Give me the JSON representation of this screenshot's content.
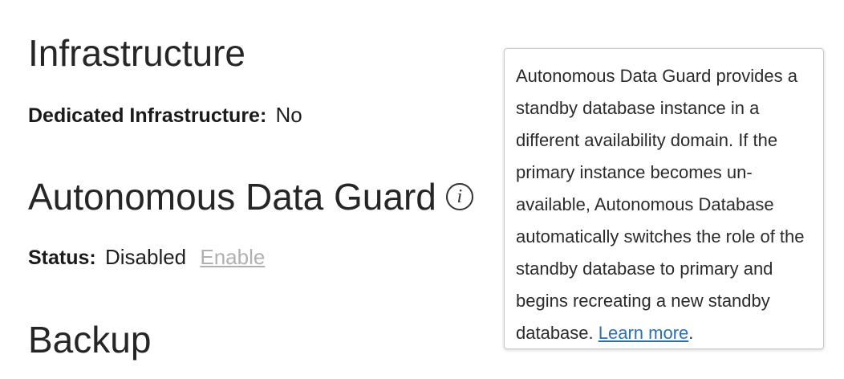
{
  "sections": {
    "infrastructure": {
      "heading": "Infrastructure",
      "dedicated_label": "Dedicated Infrastructure:",
      "dedicated_value": "No"
    },
    "data_guard": {
      "heading": "Autonomous Data Guard",
      "info_icon_glyph": "i",
      "status_label": "Status:",
      "status_value": "Disabled",
      "enable_link": "Enable"
    },
    "backup": {
      "heading": "Backup"
    }
  },
  "tooltip": {
    "body": "Autonomous Data Guard provides a standby database instance in a different availability domain. If the primary instance becomes un-available, Autonomous Database automatically switches the role of the standby database to primary and begins recreating a new standby database.",
    "link_text": "Learn more",
    "trailing": "."
  },
  "icons": {
    "info": "info-circle-icon"
  },
  "colors": {
    "link": "#2c6fb5",
    "disabled_link": "#b0b0b0",
    "text": "#222222"
  }
}
